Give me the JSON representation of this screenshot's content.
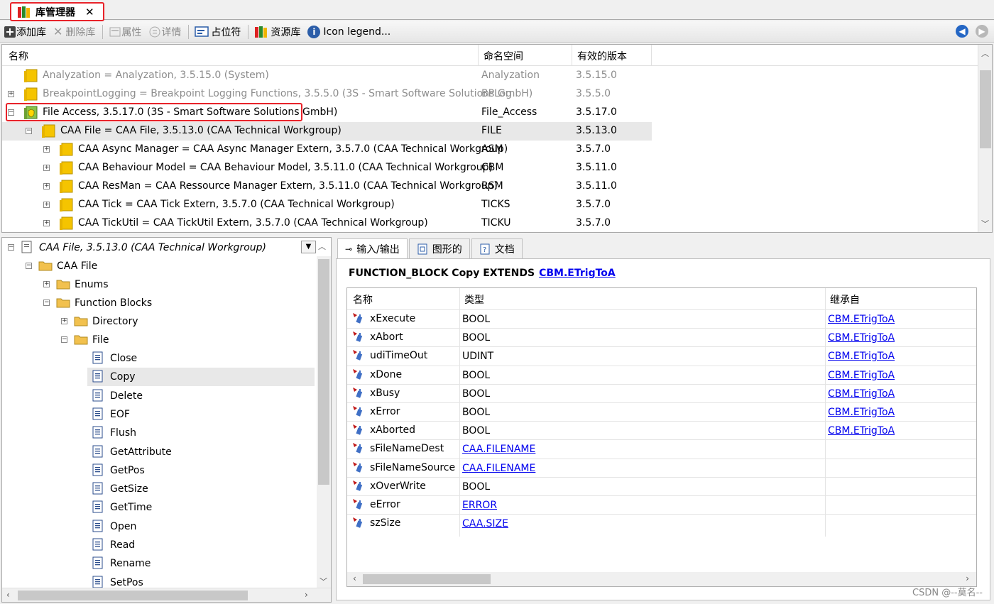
{
  "tab": {
    "title": "库管理器",
    "close": "✕"
  },
  "toolbar": {
    "add_lib": "添加库",
    "delete_lib": "删除库",
    "properties": "属性",
    "details": "详情",
    "placeholder": "占位符",
    "repository": "资源库",
    "icon_legend": "Icon legend..."
  },
  "lib_list": {
    "headers": {
      "name": "名称",
      "namespace": "命名空间",
      "version": "有效的版本"
    },
    "rows": [
      {
        "name": "Analyzation = Analyzation, 3.5.15.0 (System)",
        "ns": "Analyzation",
        "ver": "3.5.15.0"
      },
      {
        "name": "BreakpointLogging = Breakpoint Logging Functions, 3.5.5.0 (3S - Smart Software Solutions GmbH)",
        "ns": "BPLog",
        "ver": "3.5.5.0"
      },
      {
        "name": "File Access, 3.5.17.0 (3S - Smart Software Solutions GmbH)",
        "ns": "File_Access",
        "ver": "3.5.17.0"
      },
      {
        "name": "CAA File = CAA File, 3.5.13.0 (CAA Technical Workgroup)",
        "ns": "FILE",
        "ver": "3.5.13.0"
      },
      {
        "name": "CAA Async Manager = CAA Async Manager Extern, 3.5.7.0 (CAA Technical Workgroup)",
        "ns": "ASM",
        "ver": "3.5.7.0"
      },
      {
        "name": "CAA Behaviour Model = CAA Behaviour Model, 3.5.11.0 (CAA Technical Workgroup)",
        "ns": "CBM",
        "ver": "3.5.11.0"
      },
      {
        "name": "CAA ResMan = CAA Ressource Manager Extern, 3.5.11.0 (CAA Technical Workgroup)",
        "ns": "RSM",
        "ver": "3.5.11.0"
      },
      {
        "name": "CAA Tick = CAA Tick Extern, 3.5.7.0 (CAA Technical Workgroup)",
        "ns": "TICKS",
        "ver": "3.5.7.0"
      },
      {
        "name": "CAA TickUtil = CAA TickUtil Extern, 3.5.7.0 (CAA Technical Workgroup)",
        "ns": "TICKU",
        "ver": "3.5.7.0"
      }
    ]
  },
  "tree": {
    "root": "CAA File, 3.5.13.0 (CAA Technical Workgroup)",
    "nodes": [
      "CAA File",
      "Enums",
      "Function Blocks",
      "Directory",
      "File"
    ],
    "items": [
      "Close",
      "Copy",
      "Delete",
      "EOF",
      "Flush",
      "GetAttribute",
      "GetPos",
      "GetSize",
      "GetTime",
      "Open",
      "Read",
      "Rename",
      "SetPos"
    ]
  },
  "detail": {
    "tabs": [
      "输入/输出",
      "图形的",
      "文档"
    ],
    "fb_header": "FUNCTION_BLOCK  Copy EXTENDS",
    "fb_extends": "CBM.ETrigToA",
    "columns": {
      "name": "名称",
      "type": "类型",
      "inherited": "继承自"
    },
    "vars": [
      {
        "name": "xExecute",
        "type": "BOOL",
        "inh": "CBM.ETrigToA"
      },
      {
        "name": "xAbort",
        "type": "BOOL",
        "inh": "CBM.ETrigToA"
      },
      {
        "name": "udiTimeOut",
        "type": "UDINT",
        "inh": "CBM.ETrigToA"
      },
      {
        "name": "xDone",
        "type": "BOOL",
        "inh": "CBM.ETrigToA"
      },
      {
        "name": "xBusy",
        "type": "BOOL",
        "inh": "CBM.ETrigToA"
      },
      {
        "name": "xError",
        "type": "BOOL",
        "inh": "CBM.ETrigToA"
      },
      {
        "name": "xAborted",
        "type": "BOOL",
        "inh": "CBM.ETrigToA"
      },
      {
        "name": "sFileNameDest",
        "type": "CAA.FILENAME",
        "inh": ""
      },
      {
        "name": "sFileNameSource",
        "type": "CAA.FILENAME",
        "inh": ""
      },
      {
        "name": "xOverWrite",
        "type": "BOOL",
        "inh": ""
      },
      {
        "name": "eError",
        "type": "ERROR",
        "inh": ""
      },
      {
        "name": "szSize",
        "type": "CAA.SIZE",
        "inh": ""
      }
    ]
  },
  "watermark": "CSDN @--莫名--",
  "colors": {
    "highlight": "#e8232a",
    "link": "#0000ee",
    "folder": "#f2c14e",
    "lib": "#ffcc00"
  }
}
